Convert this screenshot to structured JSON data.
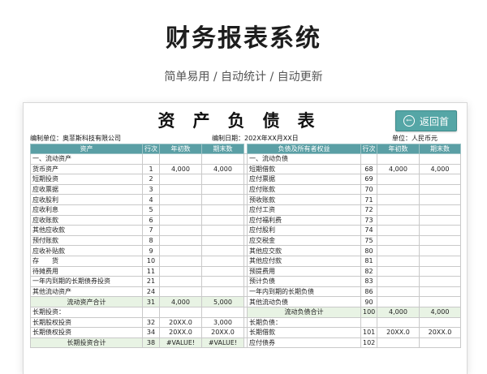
{
  "hero": {
    "title": "财务报表系统",
    "subtitle": "简单易用 / 自动统计 / 自动更新"
  },
  "sheet": {
    "title": "资产负债表",
    "back_button": "返回首",
    "back_icon": "arrow-left-circle-icon",
    "company_label": "编制单位：奥菲斯科技有限公司",
    "date_label": "编制日期：202X年XX月XX日",
    "unit_label": "单位：人民币元",
    "header_color": "#5a9fa5",
    "total_row_color": "#e8f3e4"
  },
  "columns": [
    "资产",
    "行次",
    "年初数",
    "期末数",
    "负债及所有者权益",
    "行次",
    "年初数",
    "期末数"
  ],
  "rows": [
    {
      "a": "一、流动资产",
      "an": "",
      "ab": "",
      "ae": "",
      "l": "一、流动负债",
      "ln": "",
      "lb": "",
      "le": "",
      "ai": "",
      "li": ""
    },
    {
      "a": "货币资产",
      "an": "1",
      "ab": "4,000",
      "ae": "4,000",
      "l": "短期借款",
      "ln": "68",
      "lb": "4,000",
      "le": "4,000",
      "ai": "ind2",
      "li": "ind2"
    },
    {
      "a": "短期投资",
      "an": "2",
      "ab": "",
      "ae": "",
      "l": "应付票据",
      "ln": "69",
      "lb": "",
      "le": "",
      "ai": "ind2",
      "li": "ind2"
    },
    {
      "a": "应收票据",
      "an": "3",
      "ab": "",
      "ae": "",
      "l": "应付账款",
      "ln": "70",
      "lb": "",
      "le": "",
      "ai": "ind2",
      "li": "ind2"
    },
    {
      "a": "应收股利",
      "an": "4",
      "ab": "",
      "ae": "",
      "l": "预收账款",
      "ln": "71",
      "lb": "",
      "le": "",
      "ai": "ind2",
      "li": "ind2"
    },
    {
      "a": "应收利息",
      "an": "5",
      "ab": "",
      "ae": "",
      "l": "应付工资",
      "ln": "72",
      "lb": "",
      "le": "",
      "ai": "ind2",
      "li": "ind2"
    },
    {
      "a": "应收账款",
      "an": "6",
      "ab": "",
      "ae": "",
      "l": "应付福利费",
      "ln": "73",
      "lb": "",
      "le": "",
      "ai": "ind2",
      "li": "ind2"
    },
    {
      "a": "其他应收款",
      "an": "7",
      "ab": "",
      "ae": "",
      "l": "应付股利",
      "ln": "74",
      "lb": "",
      "le": "",
      "ai": "ind2",
      "li": "ind2"
    },
    {
      "a": "预付账款",
      "an": "8",
      "ab": "",
      "ae": "",
      "l": "应交税金",
      "ln": "75",
      "lb": "",
      "le": "",
      "ai": "ind2",
      "li": "ind2"
    },
    {
      "a": "应收补贴款",
      "an": "9",
      "ab": "",
      "ae": "",
      "l": "其他应交款",
      "ln": "80",
      "lb": "",
      "le": "",
      "ai": "ind2",
      "li": "ind2"
    },
    {
      "a": "存　　货",
      "an": "10",
      "ab": "",
      "ae": "",
      "l": "其他应付款",
      "ln": "81",
      "lb": "",
      "le": "",
      "ai": "ind2",
      "li": "ind2"
    },
    {
      "a": "待摊费用",
      "an": "11",
      "ab": "",
      "ae": "",
      "l": "预提费用",
      "ln": "82",
      "lb": "",
      "le": "",
      "ai": "ind2",
      "li": "ind2"
    },
    {
      "a": "一年内到期的长期债券投资",
      "an": "21",
      "ab": "",
      "ae": "",
      "l": "预计负债",
      "ln": "83",
      "lb": "",
      "le": "",
      "ai": "ind2",
      "li": "ind2"
    },
    {
      "a": "其他流动资产",
      "an": "24",
      "ab": "",
      "ae": "",
      "l": "一年内到期的长期负债",
      "ln": "86",
      "lb": "",
      "le": "",
      "ai": "ind2",
      "li": "ind2"
    },
    {
      "a": "流动资产合计",
      "an": "31",
      "ab": "4,000",
      "ae": "5,000",
      "l": "其他流动负债",
      "ln": "90",
      "lb": "",
      "le": "",
      "ai": "ind3",
      "li": "ind2",
      "atotal": true
    },
    {
      "a": "长期投资：",
      "an": "",
      "ab": "",
      "ae": "",
      "l": "流动负债合计",
      "ln": "100",
      "lb": "4,000",
      "le": "4,000",
      "ai": "",
      "li": "ind3",
      "ltotal": true
    },
    {
      "a": "长期股权投资",
      "an": "32",
      "ab": "20XX.0",
      "ae": "3,000",
      "l": "长期负债：",
      "ln": "",
      "lb": "",
      "le": "",
      "ai": "ind3",
      "li": "ind1"
    },
    {
      "a": "长期债权投资",
      "an": "34",
      "ab": "20XX.0",
      "ae": "20XX.0",
      "l": "长期借款",
      "ln": "101",
      "lb": "20XX.0",
      "le": "20XX.0",
      "ai": "ind3",
      "li": "ind2"
    },
    {
      "a": "长期投资合计",
      "an": "38",
      "ab": "#VALUE!",
      "ae": "#VALUE!",
      "l": "应付债券",
      "ln": "102",
      "lb": "",
      "le": "",
      "ai": "ind3",
      "li": "ind2",
      "atotal": true
    }
  ]
}
